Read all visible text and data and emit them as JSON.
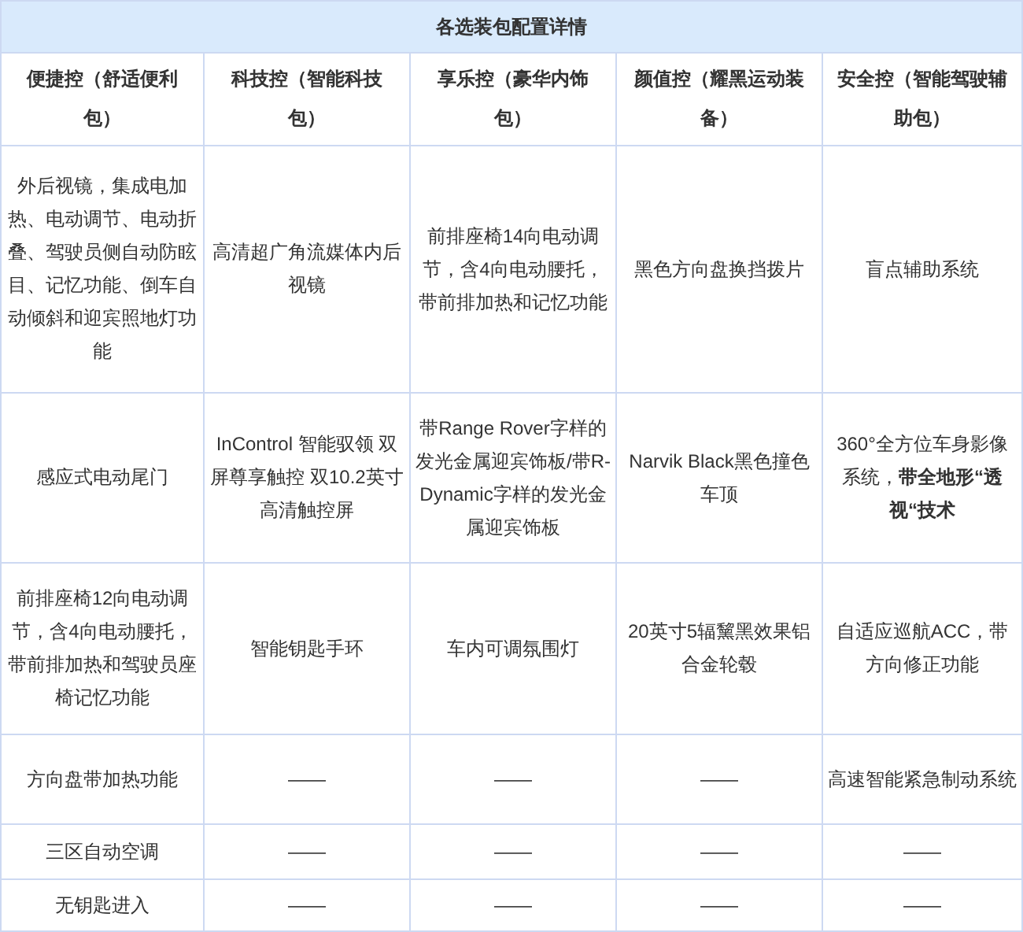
{
  "table": {
    "title": "各选装包配置详情",
    "columns": [
      "便捷控（舒适便利包）",
      "科技控（智能科技包）",
      "享乐控（豪华内饰包）",
      "颜值控（耀黑运动装备）",
      "安全控（智能驾驶辅助包）"
    ],
    "rows": [
      [
        "外后视镜，集成电加热、电动调节、电动折叠、驾驶员侧自动防眩目、记忆功能、倒车自动倾斜和迎宾照地灯功能",
        "高清超广角流媒体内后视镜",
        "前排座椅14向电动调节，含4向电动腰托，带前排加热和记忆功能",
        "黑色方向盘换挡拨片",
        "盲点辅助系统"
      ],
      [
        "感应式电动尾门",
        "InControl 智能驭领 双屏尊享触控 双10.2英寸高清触控屏",
        "带Range Rover字样的发光金属迎宾饰板/带R-Dynamic字样的发光金属迎宾饰板",
        "Narvik Black黑色撞色车顶",
        "360°全方位车身影像系统，**带全地形“透视“技术**"
      ],
      [
        "前排座椅12向电动调节，含4向电动腰托，带前排加热和驾驶员座椅记忆功能",
        "智能钥匙手环",
        "车内可调氛围灯",
        "20英寸5辐黧黑效果铝合金轮毂",
        "自适应巡航ACC，带方向修正功能"
      ],
      [
        "方向盘带加热功能",
        "——",
        "——",
        "——",
        "高速智能紧急制动系统"
      ],
      [
        "三区自动空调",
        "——",
        "——",
        "——",
        "——"
      ],
      [
        "无钥匙进入",
        "——",
        "——",
        "——",
        "——"
      ]
    ]
  }
}
